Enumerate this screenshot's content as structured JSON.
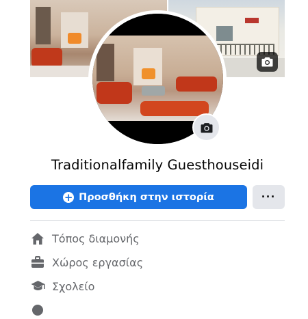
{
  "profile": {
    "name": "Traditionalfamily Guesthouseidi"
  },
  "actions": {
    "add_story_label": "Προσθήκη στην ιστορία",
    "more_label": "···"
  },
  "icons": {
    "cover_camera": "camera-icon",
    "avatar_camera": "camera-icon",
    "add_story": "plus-circle-icon"
  },
  "info": [
    {
      "icon": "home-icon",
      "label": "Τόπος διαμονής"
    },
    {
      "icon": "briefcase-icon",
      "label": "Χώρος εργασίας"
    },
    {
      "icon": "graduation-cap-icon",
      "label": "Σχολείο"
    }
  ],
  "colors": {
    "primary": "#1b74e4",
    "secondary_button": "#e4e6eb",
    "muted_text": "#65676b",
    "text": "#050505"
  }
}
